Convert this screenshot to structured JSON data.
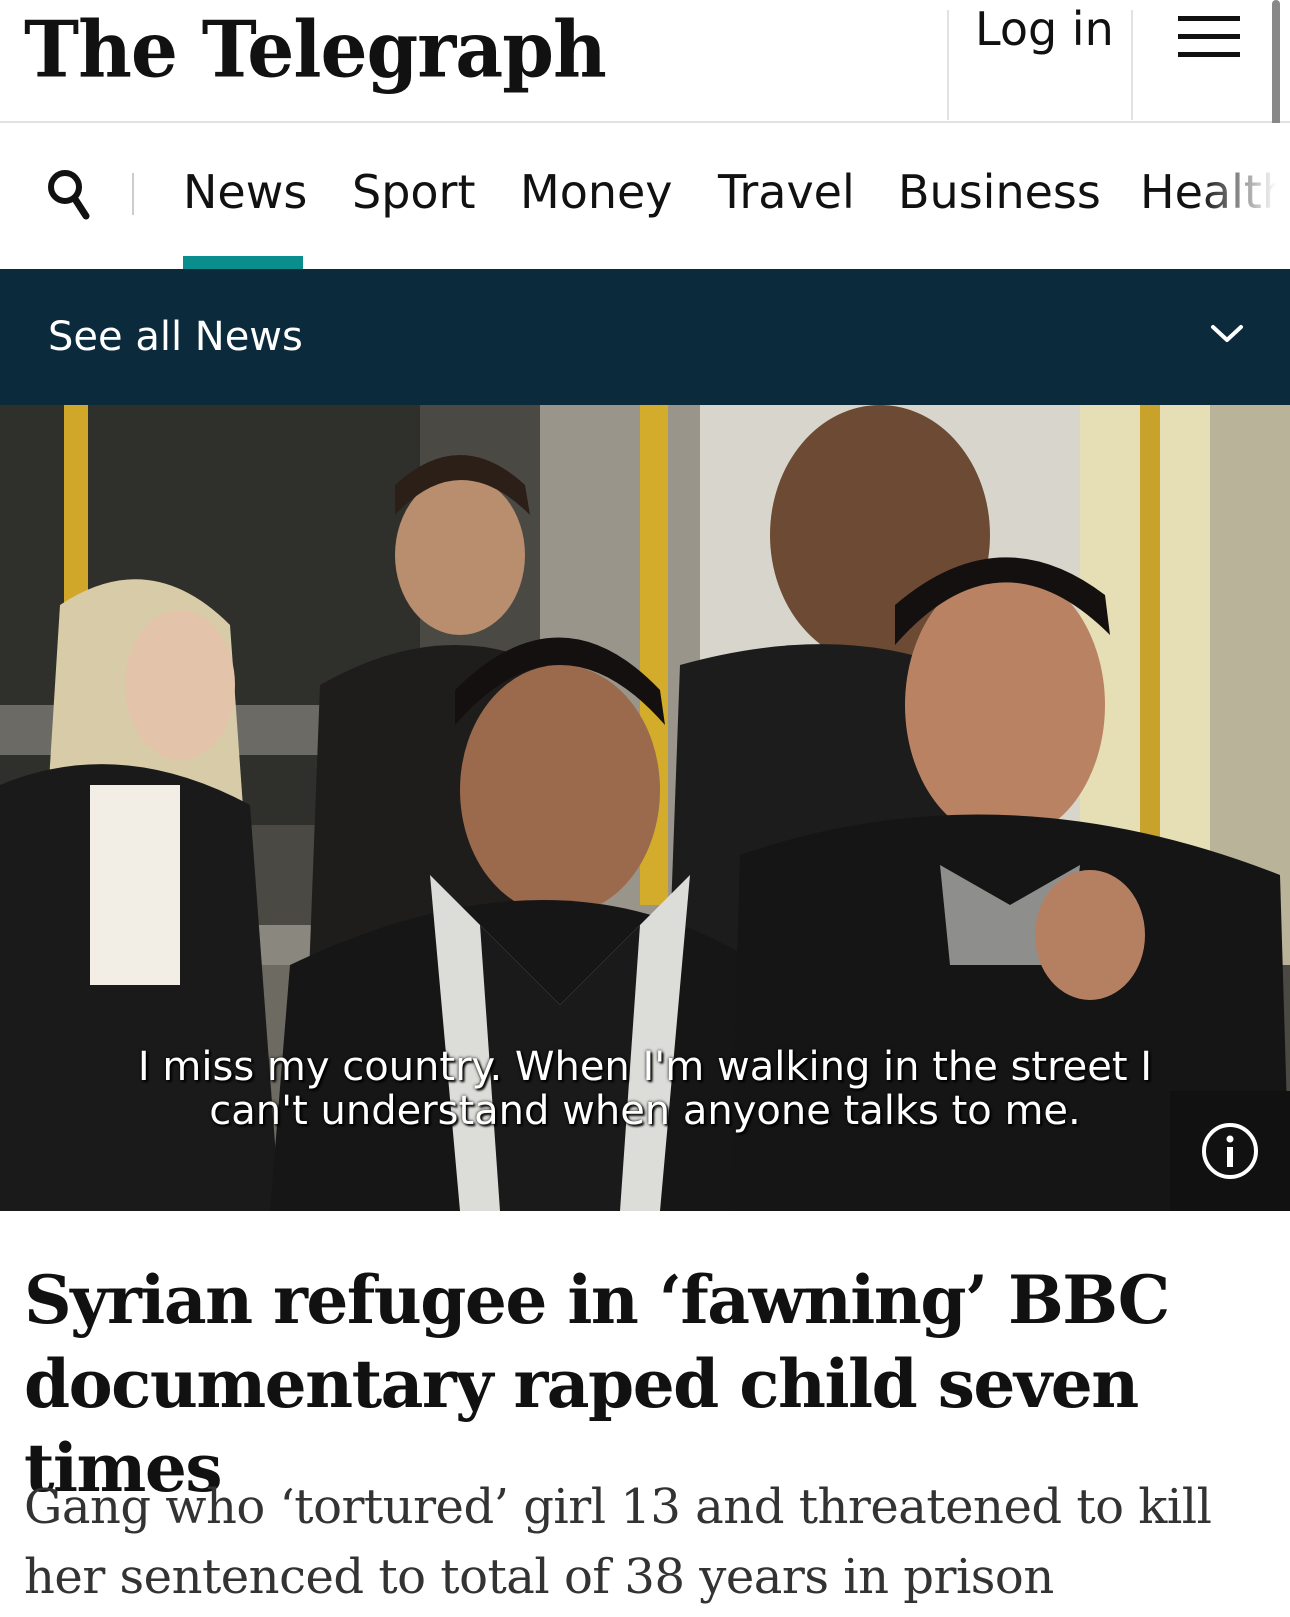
{
  "header": {
    "logo": "The Telegraph",
    "login": "Log in",
    "menu_icon": "hamburger-menu-icon"
  },
  "nav": {
    "search_icon": "search-icon",
    "items": [
      "News",
      "Sport",
      "Money",
      "Travel",
      "Business",
      "Health"
    ],
    "active": "News",
    "accent": "#0a8d8d"
  },
  "section_bar": {
    "label": "See all News",
    "icon": "chevron-down-icon",
    "background": "#0b2a3c"
  },
  "hero": {
    "subtitle_line1": "I miss my country. When I'm walking in the street I",
    "subtitle_line2": "can't understand when anyone talks to me.",
    "info_icon": "info-icon"
  },
  "article": {
    "headline": "Syrian refugee in ‘fawning’ BBC documentary raped child seven times",
    "standfirst": "Gang who ‘tortured’ girl 13 and threatened to kill her sentenced to total of 38 years in prison"
  }
}
